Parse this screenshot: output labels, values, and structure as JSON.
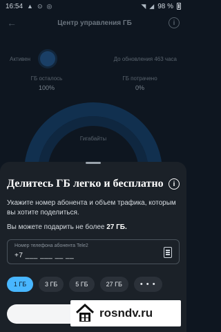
{
  "status_bar": {
    "time": "16:54",
    "battery": "98 %"
  },
  "background": {
    "title": "Центр управления ГБ",
    "active_label": "Активен",
    "update_label": "До обновления 463 часа",
    "left_stat_label": "ГБ осталось",
    "left_stat_value": "100%",
    "right_stat_label": "ГБ потрачено",
    "right_stat_value": "0%",
    "gauge_label": "Гигабайты"
  },
  "sheet": {
    "title": "Делитесь ГБ легко и бесплатно",
    "description": "Укажите номер абонента и объем трафика, которым вы хотите поделиться.",
    "limit_prefix": "Вы можете подарить не более",
    "limit_value": "27 ГБ.",
    "phone_field": {
      "label": "Номер телефона абонента Tele2",
      "value": "+7 ___ ___ __ __"
    },
    "chips": [
      "1 ГБ",
      "3 ГБ",
      "5 ГБ",
      "27 ГБ",
      "• • •"
    ],
    "selected_chip": "1 ГБ"
  },
  "watermark": {
    "text": "rosndv.ru"
  },
  "colors": {
    "accent": "#48b6ff",
    "sheet_bg": "#1b2128",
    "app_bg": "#0e1620"
  }
}
